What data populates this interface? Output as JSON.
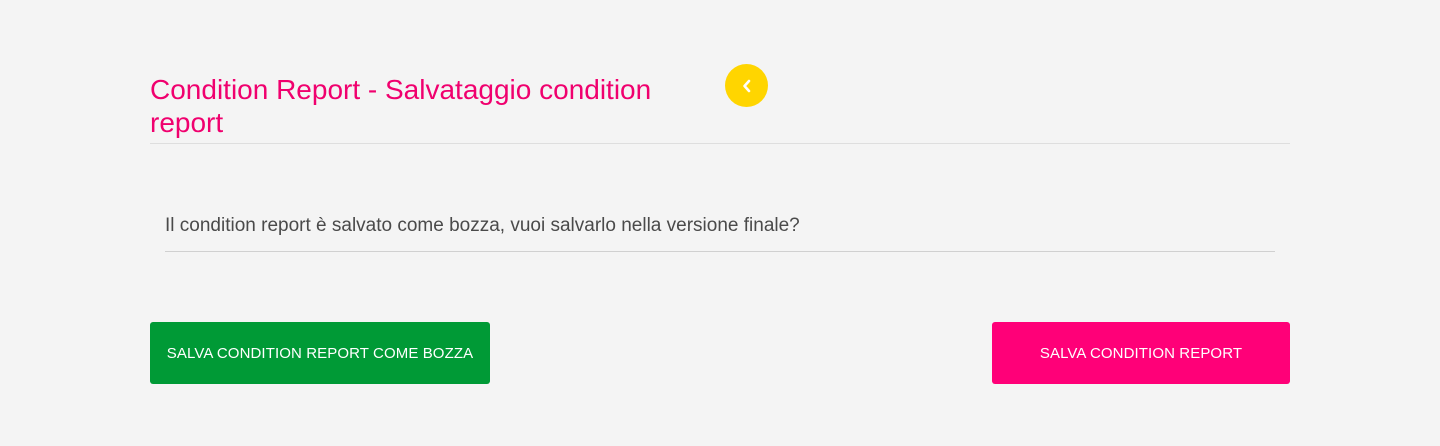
{
  "page": {
    "title": "Condition Report - Salvataggio condition report"
  },
  "header": {
    "back_icon": "chevron-left-icon",
    "back_color": "#ffd500"
  },
  "form": {
    "question": "Il condition report è salvato come bozza, vuoi salvarlo nella versione finale?"
  },
  "actions": {
    "draft_label": "SALVA CONDITION REPORT COME BOZZA",
    "draft_color": "#009a36",
    "save_label": "SALVA CONDITION REPORT",
    "save_color": "#ff0078"
  },
  "theme": {
    "accent": "#f0006e",
    "background": "#f4f4f4"
  }
}
